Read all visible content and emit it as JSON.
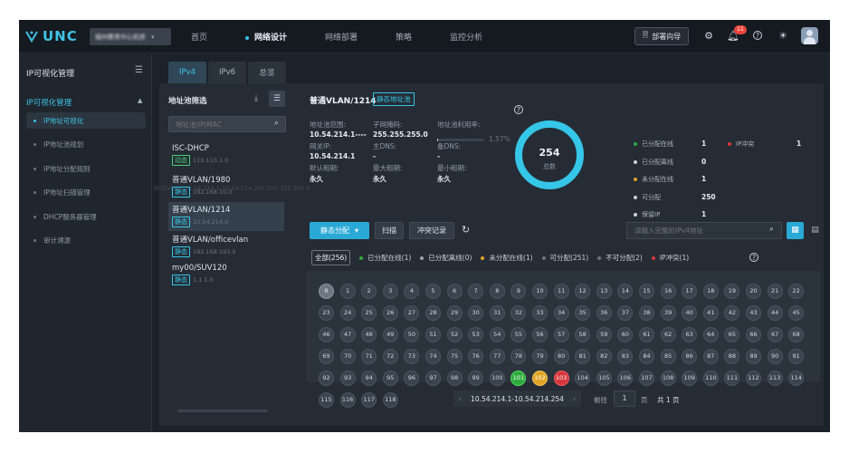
{
  "brand": "UNC",
  "tenant": {
    "name": "福州教育中心机房"
  },
  "nav": [
    "首页",
    "网络设计",
    "网络部署",
    "策略",
    "监控分析"
  ],
  "nav_active": 1,
  "top": {
    "deploy": "部署向导",
    "bell_count": "11"
  },
  "sidebar": {
    "title": "IP可视化管理",
    "group": "IP可视化管理",
    "items": [
      "IP地址可视化",
      "IP地址池规划",
      "IP地址分配规则",
      "IP地址扫描管理",
      "DHCP服务器管理",
      "审计溯源"
    ],
    "active": 0
  },
  "tabs": [
    "IPv4",
    "IPv6",
    "总览"
  ],
  "tab_active": 0,
  "pools": {
    "title": "地址池筛选",
    "search_placeholder": "地址池|IP|MAC",
    "items": [
      {
        "name": "ISC-DHCP",
        "type": "动态",
        "ip": "110.110.1.0",
        "dynamic": true
      },
      {
        "name": "普通VLAN/1980",
        "type": "静态",
        "ip": "192.168.10.0",
        "dynamic": false
      },
      {
        "name": "普通VLAN/1214",
        "type": "静态",
        "ip": "10.54.214.0",
        "dynamic": false
      },
      {
        "name": "普通VLAN/officevlan",
        "type": "静态",
        "ip": "192.168.193.0",
        "dynamic": false
      },
      {
        "name": "my00/SUV120",
        "type": "静态",
        "ip": "1.1.1.0",
        "dynamic": false
      }
    ],
    "active": 2,
    "ghost_text": "BCGVLAN 10.54.214.1-10.54.214.255 255.255.255.0"
  },
  "detail": {
    "title": "普通VLAN/1214",
    "tag": "静态地址池",
    "range_label": "地址池范围:",
    "range_value": "10.54.214.1----",
    "mask_label": "子网掩码:",
    "mask_value": "255.255.255.0",
    "util_label": "地址池利用率:",
    "util_value": "1.57%",
    "util_fraction": 0.0157,
    "gw_label": "网关IP:",
    "gw_value": "10.54.214.1",
    "dns1_label": "主DNS:",
    "dns1_value": "-",
    "dns2_label": "备DNS:",
    "dns2_value": "-",
    "lease_label": "默认租期:",
    "lease_value": "永久",
    "maxlease_label": "最大租期:",
    "maxlease_value": "永久",
    "minlease_label": "最小租期:",
    "minlease_value": "永久"
  },
  "summary": {
    "total": "254",
    "total_label": "总数",
    "legend": [
      {
        "label": "已分配在线",
        "value": "1",
        "color": "#2faa3d"
      },
      {
        "label": "已分配离线",
        "value": "0",
        "color": "#c9d1db"
      },
      {
        "label": "未分配在线",
        "value": "1",
        "color": "#e0a324"
      },
      {
        "label": "可分配",
        "value": "250",
        "color": "#c9d1db"
      },
      {
        "label": "保留IP",
        "value": "1",
        "color": "#c9d1db"
      }
    ],
    "conflict": {
      "label": "IP冲突",
      "value": "1",
      "color": "#d6363a"
    },
    "ring_color": "#35c6e8"
  },
  "actions": {
    "alloc": "静态分配",
    "scan": "扫描",
    "conflict": "冲突记录",
    "ip_search_placeholder": "请输入完整的IPv4地址"
  },
  "filters": [
    {
      "label": "全部(256)",
      "color": ""
    },
    {
      "label": "已分配在线(1)",
      "color": "#2faa3d"
    },
    {
      "label": "已分配离线(0)",
      "color": "#9aa4b0"
    },
    {
      "label": "未分配在线(1)",
      "color": "#e0a324"
    },
    {
      "label": "可分配(251)",
      "color": "#6b7581"
    },
    {
      "label": "不可分配(2)",
      "color": "#6b7581"
    },
    {
      "label": "IP冲突(1)",
      "color": "#d6363a"
    }
  ],
  "cells": {
    "count": 119,
    "special": {
      "0": "cur",
      "101": "green",
      "102": "yellow",
      "103": "red"
    }
  },
  "pager": {
    "range": "10.54.214.1-10.54.214.254",
    "goto": "前往",
    "page": "1",
    "unit": "页",
    "total": "共 1 页"
  }
}
